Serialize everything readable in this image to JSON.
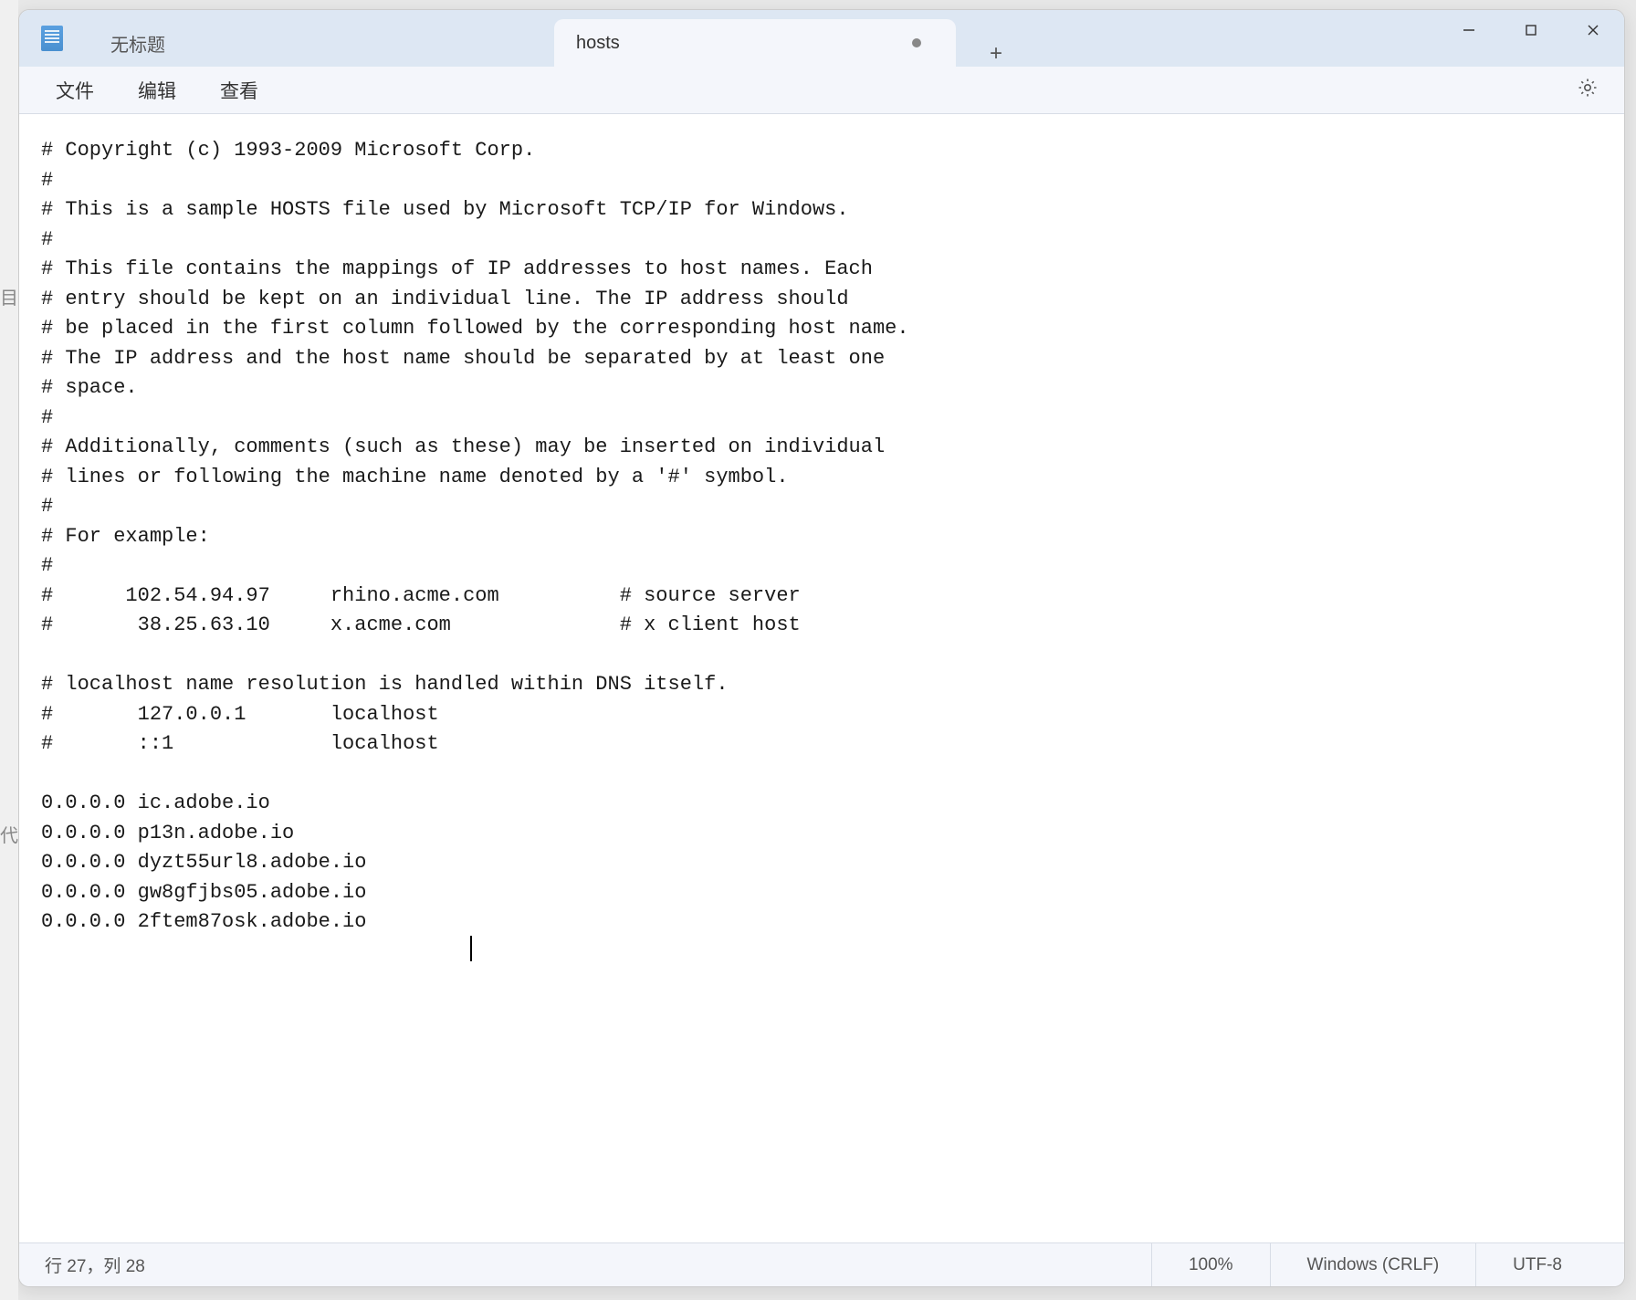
{
  "tabs": {
    "inactive_label": "无标题",
    "active_label": "hosts",
    "new_tab_symbol": "+"
  },
  "menubar": {
    "file": "文件",
    "edit": "编辑",
    "view": "查看"
  },
  "editor": {
    "content": "# Copyright (c) 1993-2009 Microsoft Corp.\n#\n# This is a sample HOSTS file used by Microsoft TCP/IP for Windows.\n#\n# This file contains the mappings of IP addresses to host names. Each\n# entry should be kept on an individual line. The IP address should\n# be placed in the first column followed by the corresponding host name.\n# The IP address and the host name should be separated by at least one\n# space.\n#\n# Additionally, comments (such as these) may be inserted on individual\n# lines or following the machine name denoted by a '#' symbol.\n#\n# For example:\n#\n#      102.54.94.97     rhino.acme.com          # source server\n#       38.25.63.10     x.acme.com              # x client host\n\n# localhost name resolution is handled within DNS itself.\n#\t127.0.0.1       localhost\n#\t::1             localhost\n\n0.0.0.0 ic.adobe.io\n0.0.0.0 p13n.adobe.io\n0.0.0.0 dyzt55url8.adobe.io\n0.0.0.0 gw8gfjbs05.adobe.io\n0.0.0.0 2ftem87osk.adobe.io"
  },
  "statusbar": {
    "position": "行 27，列 28",
    "zoom": "100%",
    "line_ending": "Windows (CRLF)",
    "encoding": "UTF-8"
  }
}
